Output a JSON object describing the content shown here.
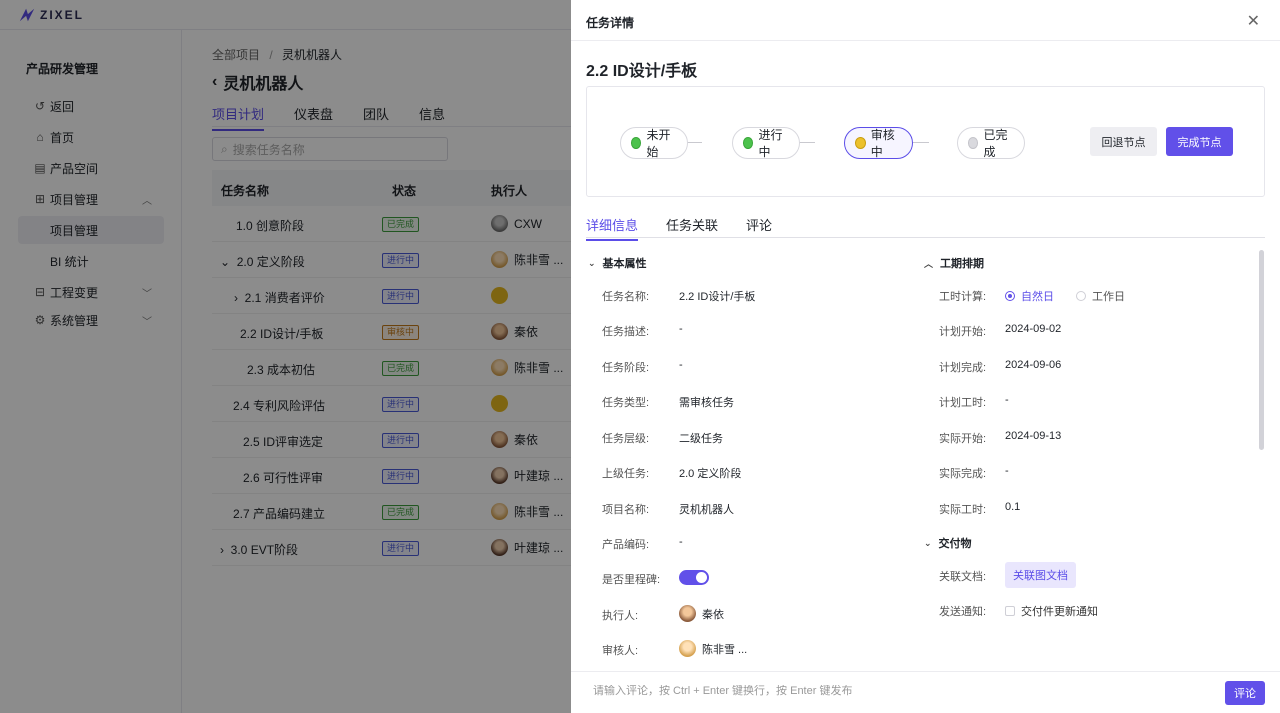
{
  "app": {
    "logo_text": "ZIXEL"
  },
  "sidebar": {
    "title": "产品研发管理",
    "items": [
      {
        "label": "返回",
        "icon": "back-icon"
      },
      {
        "label": "首页",
        "icon": "home-icon"
      },
      {
        "label": "产品空间",
        "icon": "product-space-icon"
      },
      {
        "label": "项目管理",
        "icon": "grid-icon"
      },
      {
        "label": "项目管理",
        "icon": ""
      },
      {
        "label": "BI 统计",
        "icon": ""
      },
      {
        "label": "工程变更",
        "icon": "engineering-change-icon"
      },
      {
        "label": "系统管理",
        "icon": "gear-icon"
      }
    ]
  },
  "main": {
    "breadcrumb": {
      "root": "全部项目",
      "sep": "/",
      "current": "灵机机器人"
    },
    "title": "灵机机器人",
    "tabs": [
      "项目计划",
      "仪表盘",
      "团队",
      "信息"
    ],
    "search_placeholder": "搜索任务名称",
    "columns": [
      "任务名称",
      "状态",
      "执行人"
    ],
    "rows": [
      {
        "name": "1.0 创意阶段",
        "status": "已完成",
        "assignee": "CXW"
      },
      {
        "name": "2.0 定义阶段",
        "status": "进行中",
        "assignee": "陈非雪 ..."
      },
      {
        "name": "2.1 消费者评价",
        "status": "进行中",
        "assignee": ""
      },
      {
        "name": "2.2 ID设计/手板",
        "status": "审核中",
        "assignee": "秦依"
      },
      {
        "name": "2.3 成本初估",
        "status": "已完成",
        "assignee": "陈非雪 ..."
      },
      {
        "name": "2.4 专利风险评估",
        "status": "进行中",
        "assignee": ""
      },
      {
        "name": "2.5 ID评审选定",
        "status": "进行中",
        "assignee": "秦依"
      },
      {
        "name": "2.6 可行性评审",
        "status": "进行中",
        "assignee": "叶建琼 ..."
      },
      {
        "name": "2.7 产品编码建立",
        "status": "已完成",
        "assignee": "陈非雪 ..."
      },
      {
        "name": "3.0 EVT阶段",
        "status": "进行中",
        "assignee": "叶建琼 ..."
      }
    ]
  },
  "drawer": {
    "header": "任务详情",
    "close_icon": "close-icon",
    "task_title": "2.2 ID设计/手板",
    "flow": {
      "nodes": [
        "未开始",
        "进行中",
        "审核中",
        "已完成"
      ],
      "back_button": "回退节点",
      "complete_button": "完成节点"
    },
    "tabs": [
      "详细信息",
      "任务关联",
      "评论"
    ],
    "basic": {
      "title": "基本属性",
      "fields": [
        {
          "label": "任务名称:",
          "value": "2.2 ID设计/手板"
        },
        {
          "label": "任务描述:",
          "value": "-"
        },
        {
          "label": "任务阶段:",
          "value": "-"
        },
        {
          "label": "任务类型:",
          "value": "需审核任务"
        },
        {
          "label": "任务层级:",
          "value": "二级任务"
        },
        {
          "label": "上级任务:",
          "value": "2.0 定义阶段"
        },
        {
          "label": "项目名称:",
          "value": "灵机机器人"
        },
        {
          "label": "产品编码:",
          "value": "-"
        },
        {
          "label": "是否里程碑:",
          "value": ""
        },
        {
          "label": "执行人:",
          "value": "秦依"
        },
        {
          "label": "审核人:",
          "value": "陈非雪 ..."
        }
      ],
      "milestone_on": true
    },
    "schedule": {
      "title": "工期排期",
      "calc_label": "工时计算:",
      "calc_options": [
        "自然日",
        "工作日"
      ],
      "selected": "自然日",
      "fields": [
        {
          "label": "计划开始:",
          "value": "2024-09-02"
        },
        {
          "label": "计划完成:",
          "value": "2024-09-06"
        },
        {
          "label": "计划工时:",
          "value": "-"
        },
        {
          "label": "实际开始:",
          "value": "2024-09-13"
        },
        {
          "label": "实际完成:",
          "value": "-"
        },
        {
          "label": "实际工时:",
          "value": "0.1"
        }
      ]
    },
    "deliverables": {
      "title": "交付物",
      "doc_label": "关联文档:",
      "doc_button": "关联图文档",
      "notify_label": "发送通知:",
      "notify_text": "交付件更新通知",
      "notify_checked": false
    },
    "footer": {
      "placeholder": "请输入评论，按 Ctrl + Enter 键换行，按 Enter 键发布",
      "submit": "评论"
    }
  },
  "colors": {
    "accent": "#6150e9",
    "done": "#3c9d3c",
    "progress": "#4a5ad8",
    "review": "#c47a1a"
  }
}
